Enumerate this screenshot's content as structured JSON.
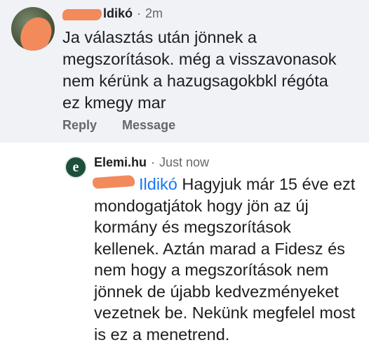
{
  "comment": {
    "author_visible": "ldikó",
    "time": "2m",
    "separator": "·",
    "text": "Ja választás után jönnek a\nmegszorítások. még a visszavonasok\nnem kérünk a hazugsagokbkl  régóta\nez kmegy mar",
    "actions": {
      "reply_label": "Reply",
      "message_label": "Message"
    }
  },
  "reply": {
    "author": "Elemi.hu",
    "avatar_letter": "e",
    "separator": "·",
    "time": "Just now",
    "mention_visible": "Ildikó",
    "text": " Hagyjuk már 15 éve ezt mondogatjátok hogy jön az új kormány és megszorítások kellenek. Aztán marad a Fidesz és nem hogy a megszorítások nem jönnek de újabb kedvezményeket vezetnek be. Nekünk megfelel most is ez a menetrend."
  },
  "colors": {
    "background_top": "#f0f2f5",
    "background_reply": "#ffffff",
    "text_primary": "#1c1e21",
    "text_secondary": "#65676b",
    "mention": "#1877f2",
    "redaction": "#f28a5c",
    "page_avatar": "#1d4f3a"
  }
}
